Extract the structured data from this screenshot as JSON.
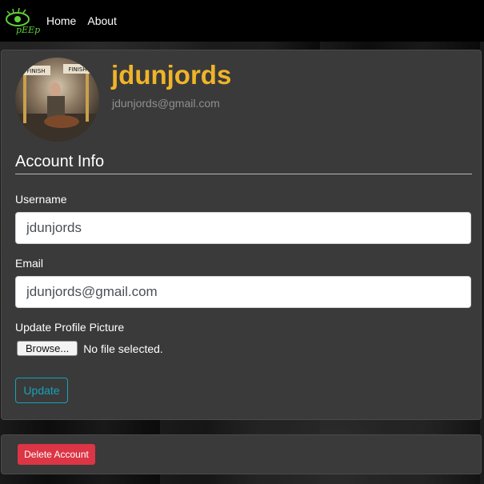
{
  "navbar": {
    "brand_text": "pEEp",
    "links": [
      "Home",
      "About"
    ]
  },
  "profile": {
    "username": "jdunjords",
    "email": "jdunjords@gmail.com",
    "avatar_signs": [
      "FINISH",
      "FINISH"
    ]
  },
  "form": {
    "legend": "Account Info",
    "username_label": "Username",
    "username_value": "jdunjords",
    "email_label": "Email",
    "email_value": "jdunjords@gmail.com",
    "picture_label": "Update Profile Picture",
    "browse_label": "Browse...",
    "file_status": "No file selected.",
    "update_label": "Update"
  },
  "danger": {
    "delete_label": "Delete Account"
  },
  "colors": {
    "accent": "#f0b429",
    "info": "#17a2b8",
    "danger": "#dc3545",
    "brand_green": "#5fd13a"
  }
}
